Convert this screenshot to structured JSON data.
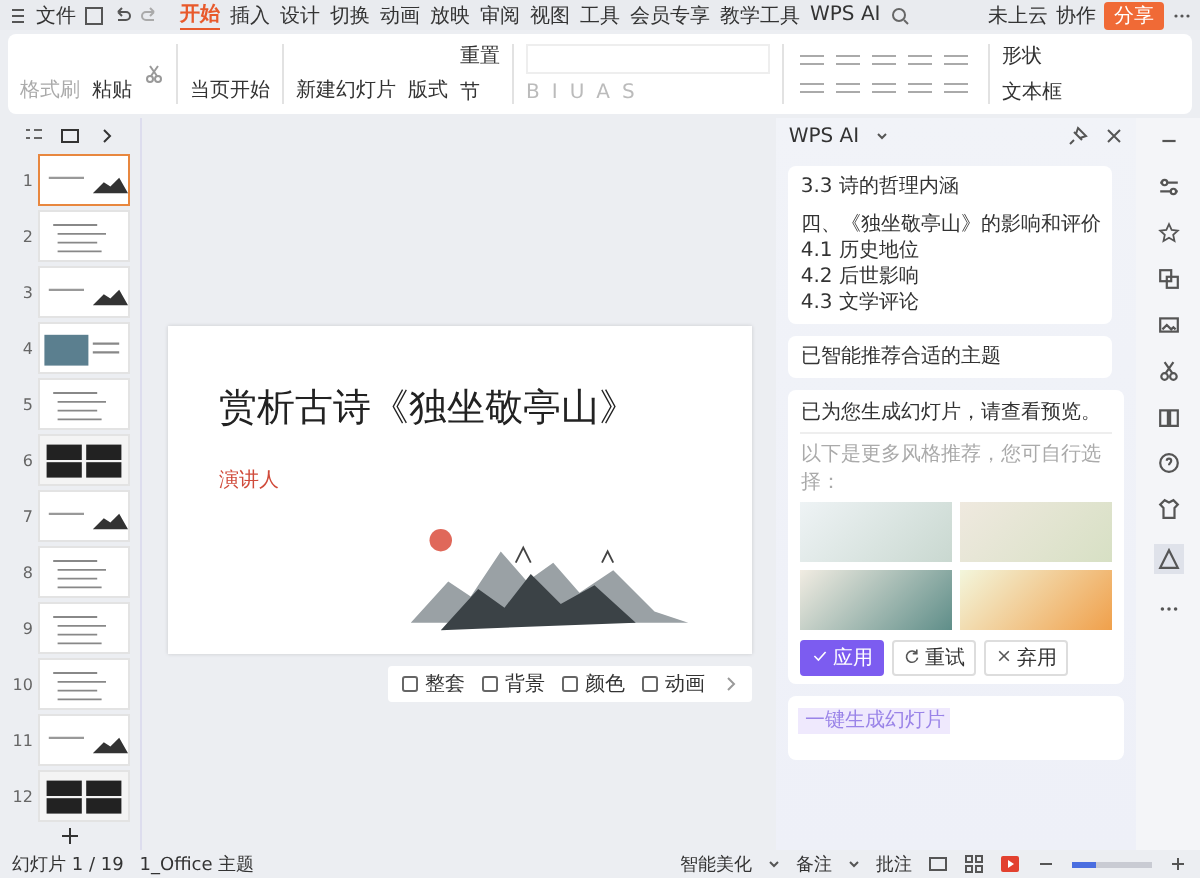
{
  "menu": {
    "file": "文件"
  },
  "tabs": [
    {
      "label": "开始",
      "selected": true
    },
    {
      "label": "插入",
      "selected": false
    },
    {
      "label": "设计",
      "selected": false
    },
    {
      "label": "切换",
      "selected": false
    },
    {
      "label": "动画",
      "selected": false
    },
    {
      "label": "放映",
      "selected": false
    },
    {
      "label": "审阅",
      "selected": false
    },
    {
      "label": "视图",
      "selected": false
    },
    {
      "label": "工具",
      "selected": false
    },
    {
      "label": "会员专享",
      "selected": false
    },
    {
      "label": "教学工具",
      "selected": false
    }
  ],
  "ai_tab": "WPS AI",
  "account": {
    "cloud": "未上云",
    "collab": "协作",
    "share": "分享"
  },
  "ribbon": {
    "format_painter": {
      "label": "格式刷",
      "disabled": true
    },
    "paste": "粘贴",
    "play": "当页开始",
    "new_slide": "新建幻灯片",
    "layout": "版式",
    "reset": "重置",
    "section": "节",
    "format_buttons": [
      "B",
      "I",
      "U",
      "A",
      "S"
    ],
    "shape": "形状",
    "textbox": "文本框"
  },
  "slides": [
    {
      "number": "1",
      "selected": true,
      "kind": "title"
    },
    {
      "number": "2",
      "selected": false,
      "kind": "list"
    },
    {
      "number": "3",
      "selected": false,
      "kind": "title"
    },
    {
      "number": "4",
      "selected": false,
      "kind": "photo"
    },
    {
      "number": "5",
      "selected": false,
      "kind": "list"
    },
    {
      "number": "6",
      "selected": false,
      "kind": "dark"
    },
    {
      "number": "7",
      "selected": false,
      "kind": "title"
    },
    {
      "number": "8",
      "selected": false,
      "kind": "list"
    },
    {
      "number": "9",
      "selected": false,
      "kind": "list"
    },
    {
      "number": "10",
      "selected": false,
      "kind": "list"
    },
    {
      "number": "11",
      "selected": false,
      "kind": "title"
    },
    {
      "number": "12",
      "selected": false,
      "kind": "dark"
    }
  ],
  "slide": {
    "title": "赏析古诗《独坐敬亭山》",
    "presenter": "演讲人"
  },
  "slide_tools": [
    "整套",
    "背景",
    "颜色",
    "动画"
  ],
  "ai_panel": {
    "title": "WPS AI",
    "outline": [
      "3.3 诗的哲理内涵",
      "四、《独坐敬亭山》的影响和评价",
      "4.1 历史地位",
      "4.2 后世影响",
      "4.3 文学评论"
    ],
    "notice": "已智能推荐合适的主题",
    "result": "已为您生成幻灯片，请查看预览。",
    "hint": "以下是更多风格推荐，您可自行选择：",
    "buttons": [
      {
        "label": "应用",
        "kind": "primary"
      },
      {
        "label": "重试",
        "kind": "retry"
      },
      {
        "label": "弃用",
        "kind": "discard"
      }
    ],
    "chip": "一键生成幻灯片"
  },
  "status_bar": {
    "slide": "幻灯片 1 / 19",
    "theme": "1_Office 主题",
    "beautify": "智能美化",
    "notes": "备注",
    "comments": "批注",
    "zoom": {
      "level": 0.3
    }
  }
}
